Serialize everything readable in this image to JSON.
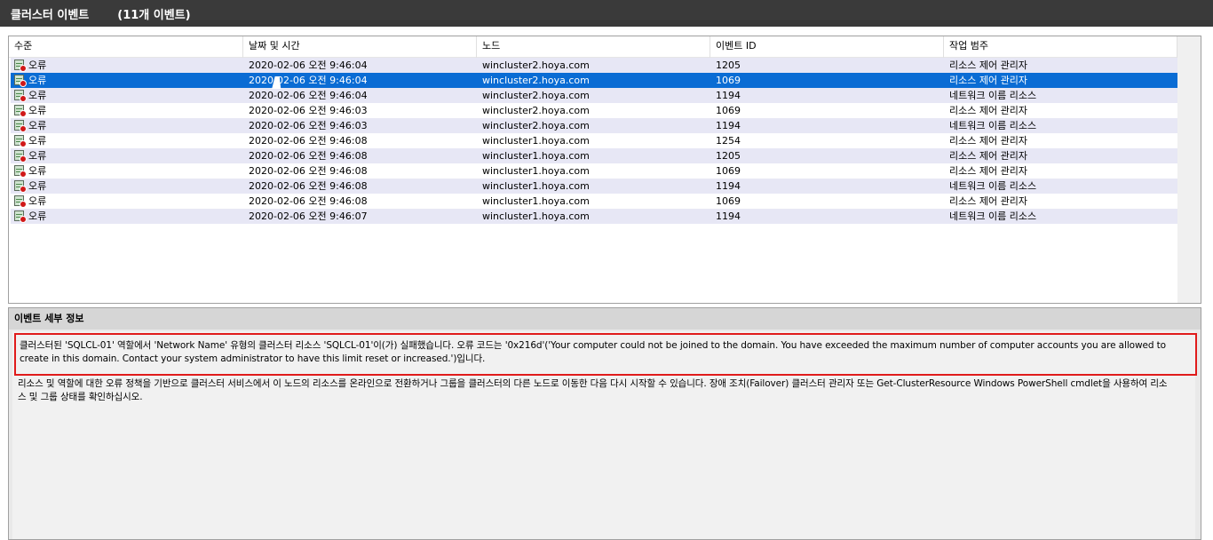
{
  "title": {
    "text": "클러스터 이벤트",
    "count": "(11개 이벤트)"
  },
  "columns": [
    "수준",
    "날짜 및 시간",
    "노드",
    "이벤트 ID",
    "작업 범주"
  ],
  "rows": [
    {
      "level": "오류",
      "datetime": "2020-02-06 오전 9:46:04",
      "node": "wincluster2.hoya.com",
      "event_id": "1205",
      "category": "리소스 제어 관리자"
    },
    {
      "level": "오류",
      "datetime": "2020-02-06 오전 9:46:04",
      "node": "wincluster2.hoya.com",
      "event_id": "1069",
      "category": "리소스 제어 관리자",
      "selected": true
    },
    {
      "level": "오류",
      "datetime": "2020-02-06 오전 9:46:04",
      "node": "wincluster2.hoya.com",
      "event_id": "1194",
      "category": "네트워크 이름 리소스"
    },
    {
      "level": "오류",
      "datetime": "2020-02-06 오전 9:46:03",
      "node": "wincluster2.hoya.com",
      "event_id": "1069",
      "category": "리소스 제어 관리자"
    },
    {
      "level": "오류",
      "datetime": "2020-02-06 오전 9:46:03",
      "node": "wincluster2.hoya.com",
      "event_id": "1194",
      "category": "네트워크 이름 리소스"
    },
    {
      "level": "오류",
      "datetime": "2020-02-06 오전 9:46:08",
      "node": "wincluster1.hoya.com",
      "event_id": "1254",
      "category": "리소스 제어 관리자"
    },
    {
      "level": "오류",
      "datetime": "2020-02-06 오전 9:46:08",
      "node": "wincluster1.hoya.com",
      "event_id": "1205",
      "category": "리소스 제어 관리자"
    },
    {
      "level": "오류",
      "datetime": "2020-02-06 오전 9:46:08",
      "node": "wincluster1.hoya.com",
      "event_id": "1069",
      "category": "리소스 제어 관리자"
    },
    {
      "level": "오류",
      "datetime": "2020-02-06 오전 9:46:08",
      "node": "wincluster1.hoya.com",
      "event_id": "1194",
      "category": "네트워크 이름 리소스"
    },
    {
      "level": "오류",
      "datetime": "2020-02-06 오전 9:46:08",
      "node": "wincluster1.hoya.com",
      "event_id": "1069",
      "category": "리소스 제어 관리자"
    },
    {
      "level": "오류",
      "datetime": "2020-02-06 오전 9:46:07",
      "node": "wincluster1.hoya.com",
      "event_id": "1194",
      "category": "네트워크 이름 리소스"
    }
  ],
  "details": {
    "header": "이벤트 세부 정보",
    "message1": "클러스터된 'SQLCL-01' 역할에서 'Network Name' 유형의 클러스터 리소스 'SQLCL-01'이(가) 실패했습니다. 오류 코드는 '0x216d'('Your computer could not be joined to the domain. You have exceeded the maximum number of computer accounts you are allowed to create in this domain. Contact your system administrator to have this limit reset or increased.')입니다.",
    "message2": "리소스 및 역할에 대한 오류 정책을 기반으로 클러스터 서비스에서 이 노드의 리소스를 온라인으로 전환하거나 그룹을 클러스터의 다른 노드로 이동한 다음 다시 시작할 수 있습니다. 장애 조치(Failover) 클러스터 관리자 또는 Get-ClusterResource Windows PowerShell cmdlet을 사용하여 리소스 및 그룹 상태를 확인하십시오."
  },
  "icons": {
    "level": "error-server-icon"
  },
  "colors": {
    "selected": "#0a6cd4",
    "highlight_border": "#e01b1b",
    "title_bg": "#3a3a3a"
  }
}
